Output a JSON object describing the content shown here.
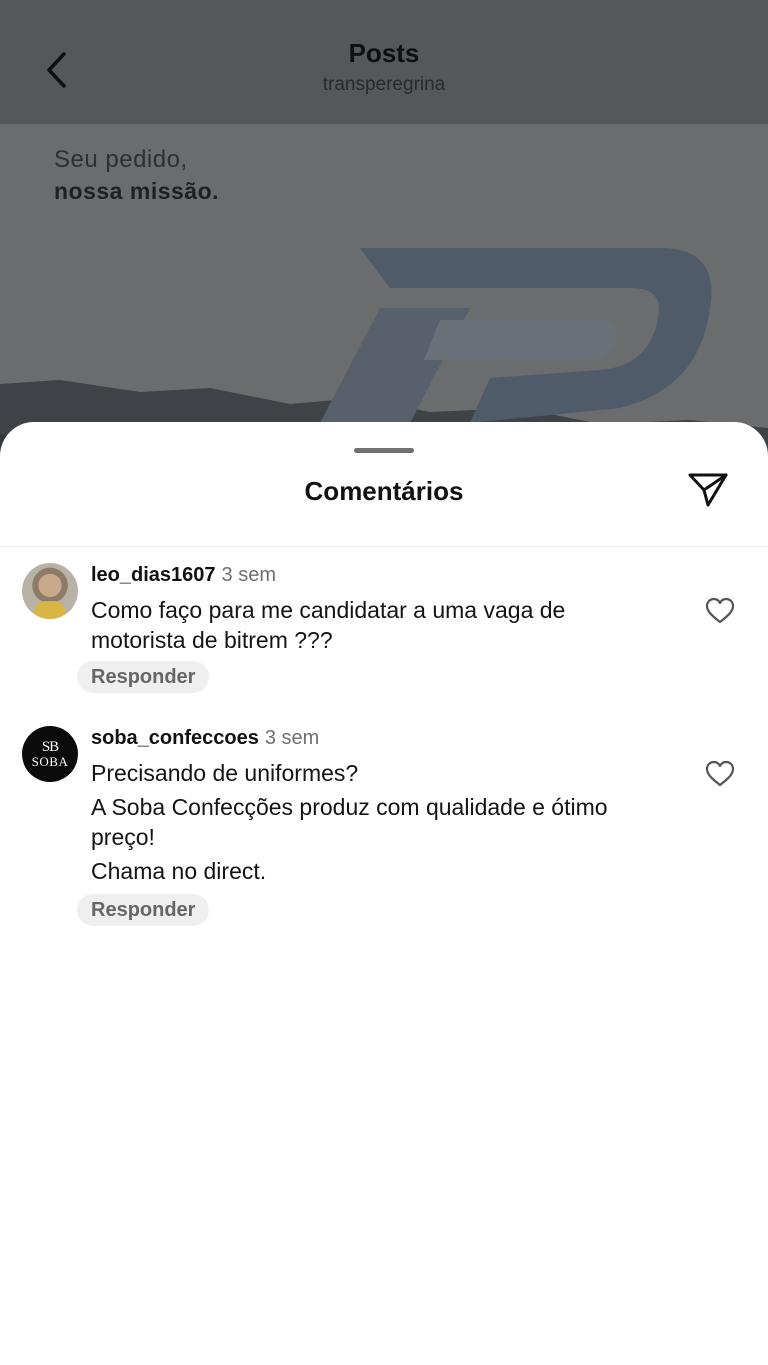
{
  "header": {
    "title": "Posts",
    "subtitle": "transperegrina",
    "back_icon": "chevron-left-icon"
  },
  "post": {
    "slogan_line1": "Seu pedido,",
    "slogan_line2": "nossa missão."
  },
  "sheet": {
    "title": "Comentários",
    "filter_icon": "filter-icon"
  },
  "comments": [
    {
      "username": "leo_dias1607",
      "time": "3 sem",
      "lines": [
        "Como faço para me candidatar a uma vaga de",
        "motorista de bitrem ???"
      ],
      "reply_label": "Responder",
      "avatar": "profile-photo"
    },
    {
      "username": "soba_confeccoes",
      "time": "3 sem",
      "lines": [
        "Precisando de uniformes?",
        "A Soba Confecções produz com qualidade e ótimo",
        "preço!",
        "Chama no direct."
      ],
      "reply_label": "Responder",
      "avatar_mono": "SB",
      "avatar_word": "SOBA"
    }
  ],
  "colors": {
    "overlay": "#5e6164",
    "sheet_bg": "#ffffff",
    "reply_bg": "#efefef",
    "text_primary": "#111111",
    "text_secondary": "#707070"
  }
}
